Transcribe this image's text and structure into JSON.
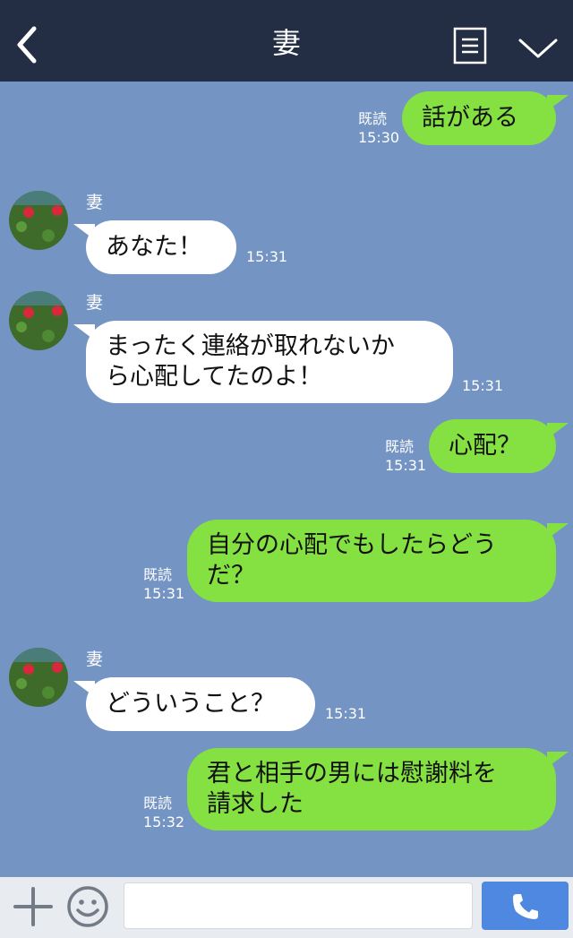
{
  "header": {
    "title": "妻"
  },
  "messages": [
    {
      "text": "話がある",
      "status": "既読",
      "time": "15:30"
    },
    {
      "sender": "妻",
      "text": "あなた！",
      "time": "15:31"
    },
    {
      "sender": "妻",
      "lines": [
        "まったく連絡が取れないか",
        "ら心配してたのよ！"
      ],
      "time": "15:31"
    },
    {
      "text": "心配？",
      "status": "既読",
      "time": "15:31"
    },
    {
      "lines": [
        "自分の心配でもしたらどう",
        "だ？"
      ],
      "status": "既読",
      "time": "15:31"
    },
    {
      "sender": "妻",
      "text": "どういうこと？",
      "time": "15:31"
    },
    {
      "lines": [
        "君と相手の男には慰謝料を",
        "請求した"
      ],
      "status": "既読",
      "time": "15:32"
    }
  ],
  "colors": {
    "background": "#7494c3",
    "header": "#232e45",
    "bubble_outgoing": "#84e141",
    "bubble_incoming": "#ffffff",
    "call_button": "#4e88e1"
  },
  "icons": {
    "back": "back-icon",
    "menu": "menu-icon",
    "collapse": "chevron-down-icon",
    "add": "plus-icon",
    "emoji": "smile-icon",
    "call": "phone-icon"
  }
}
